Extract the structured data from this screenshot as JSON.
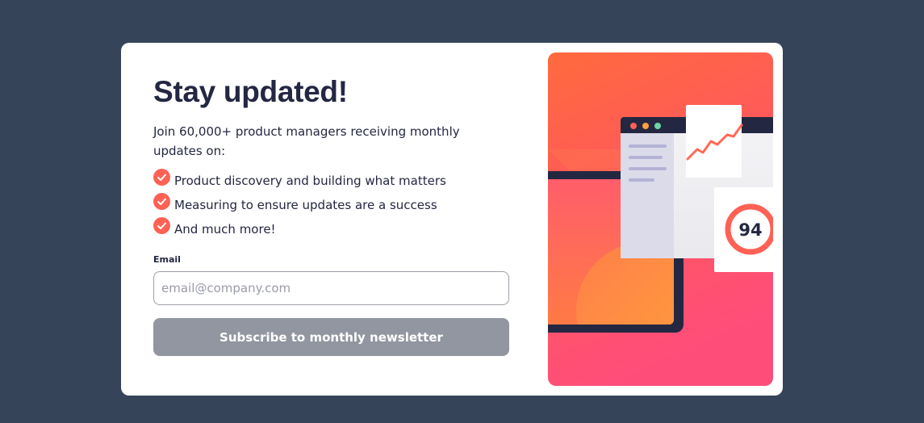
{
  "signup": {
    "title": "Stay updated!",
    "intro": "Join 60,000+ product managers receiving monthly updates on:",
    "features": [
      "Product discovery and building what matters",
      "Measuring to ensure updates are a success",
      "And much more!"
    ],
    "email_label": "Email",
    "email_placeholder": "email@company.com",
    "email_value": "",
    "subscribe_label": "Subscribe to monthly newsletter"
  },
  "illustration": {
    "score": "94"
  },
  "colors": {
    "background": "#36445a",
    "card": "#ffffff",
    "text": "#242742",
    "accent": "#ff6155",
    "button": "#9196a0"
  },
  "icons": {
    "feature_bullet": "check-circle-icon"
  }
}
